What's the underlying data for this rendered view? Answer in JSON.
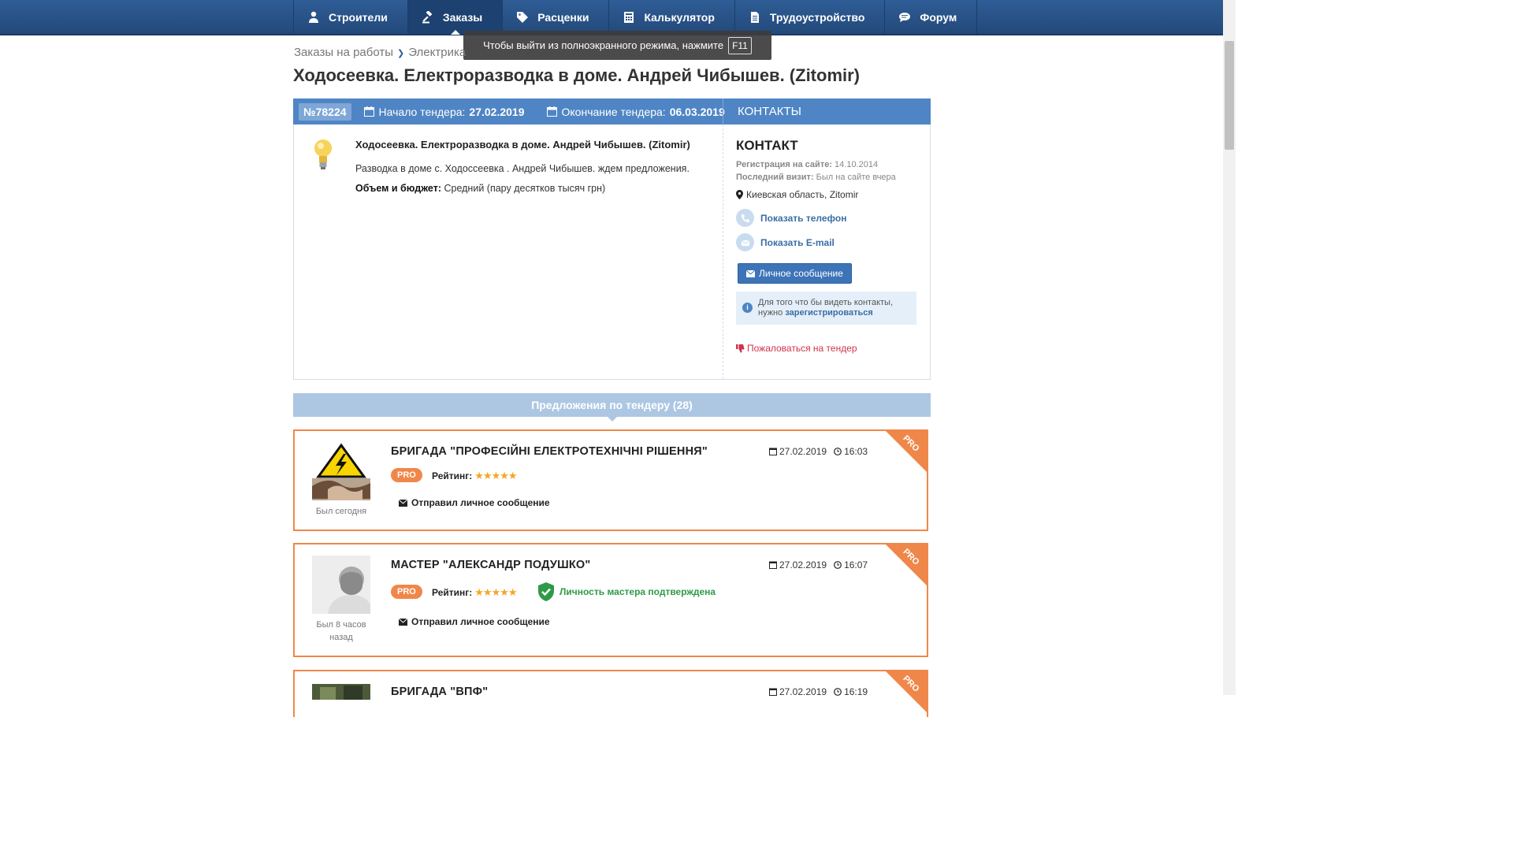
{
  "nav": [
    {
      "label": "Строители",
      "icon": "user-icon"
    },
    {
      "label": "Заказы",
      "icon": "gavel-icon",
      "active": true
    },
    {
      "label": "Расценки",
      "icon": "tag-icon"
    },
    {
      "label": "Калькулятор",
      "icon": "calculator-icon"
    },
    {
      "label": "Трудоустройство",
      "icon": "document-icon"
    },
    {
      "label": "Форум",
      "icon": "chat-icon"
    }
  ],
  "fullscreen_tip": {
    "text": "Чтобы выйти из полноэкранного режима, нажмите",
    "key": "F11"
  },
  "breadcrumb": [
    "Заказы на работы",
    "Электрика"
  ],
  "page_title": "Ходосеевка. Електроразводка в доме. Андрей Чибышев. (Zitomir)",
  "tender": {
    "id": "№78224",
    "start_label": "Начало тендера:",
    "start_date": "27.02.2019",
    "end_label": "Окончание тендера:",
    "end_date": "06.03.2019",
    "contacts_header": "КОНТАКТЫ",
    "subtitle": "Ходосеевка. Електроразводка в доме. Андрей Чибышев. (Zitomir)",
    "description": "Разводка в доме с. Ходоссеевка . Андрей Чибышев. ждем предложения.",
    "budget_label": "Объем и бюджет:",
    "budget_value": "Средний (пару десятков тысяч грн)"
  },
  "contact": {
    "title": "КОНТАКТ",
    "reg_label": "Регистрация на сайте:",
    "reg_value": "14.10.2014",
    "visit_label": "Последний визит:",
    "visit_value": "Был на сайте вчера",
    "location": "Киевская область, Zitomir",
    "show_phone": "Показать телефон",
    "show_email": "Показать E-mail",
    "message_button": "Личное сообщение",
    "info_text": "Для того что бы видеть контакты, нужно",
    "info_link": "зарегистрироваться",
    "complain": "Пожаловаться на тендер"
  },
  "proposals_header": "Предложения по тендеру (28)",
  "proposals": [
    {
      "name": "БРИГАДА \"ПРОФЕСІЙНІ ЕЛЕКТРОТЕХНІЧНІ РІШЕННЯ\"",
      "date": "27.02.2019",
      "time": "16:03",
      "pro": "PRO",
      "ribbon": "PRO",
      "rating_label": "Рейтинг:",
      "stars": "★★★★★",
      "sent": "Отправил личное сообщение",
      "last_seen": "Был сегодня"
    },
    {
      "name": "МАСТЕР \"АЛЕКСАНДР ПОДУШКО\"",
      "date": "27.02.2019",
      "time": "16:07",
      "pro": "PRO",
      "ribbon": "PRO",
      "rating_label": "Рейтинг:",
      "stars": "★★★★★",
      "verified": "Личность мастера подтверждена",
      "sent": "Отправил личное сообщение",
      "last_seen": "Был 8 часов назад"
    },
    {
      "name": "БРИГАДА \"ВПФ\"",
      "date": "27.02.2019",
      "time": "16:19",
      "ribbon": "PRO"
    }
  ],
  "colors": {
    "nav_bg": "#2f5d96",
    "accent": "#4f85c4",
    "pro": "#f0874a",
    "verified": "#2e9a48",
    "danger": "#d1334a"
  }
}
